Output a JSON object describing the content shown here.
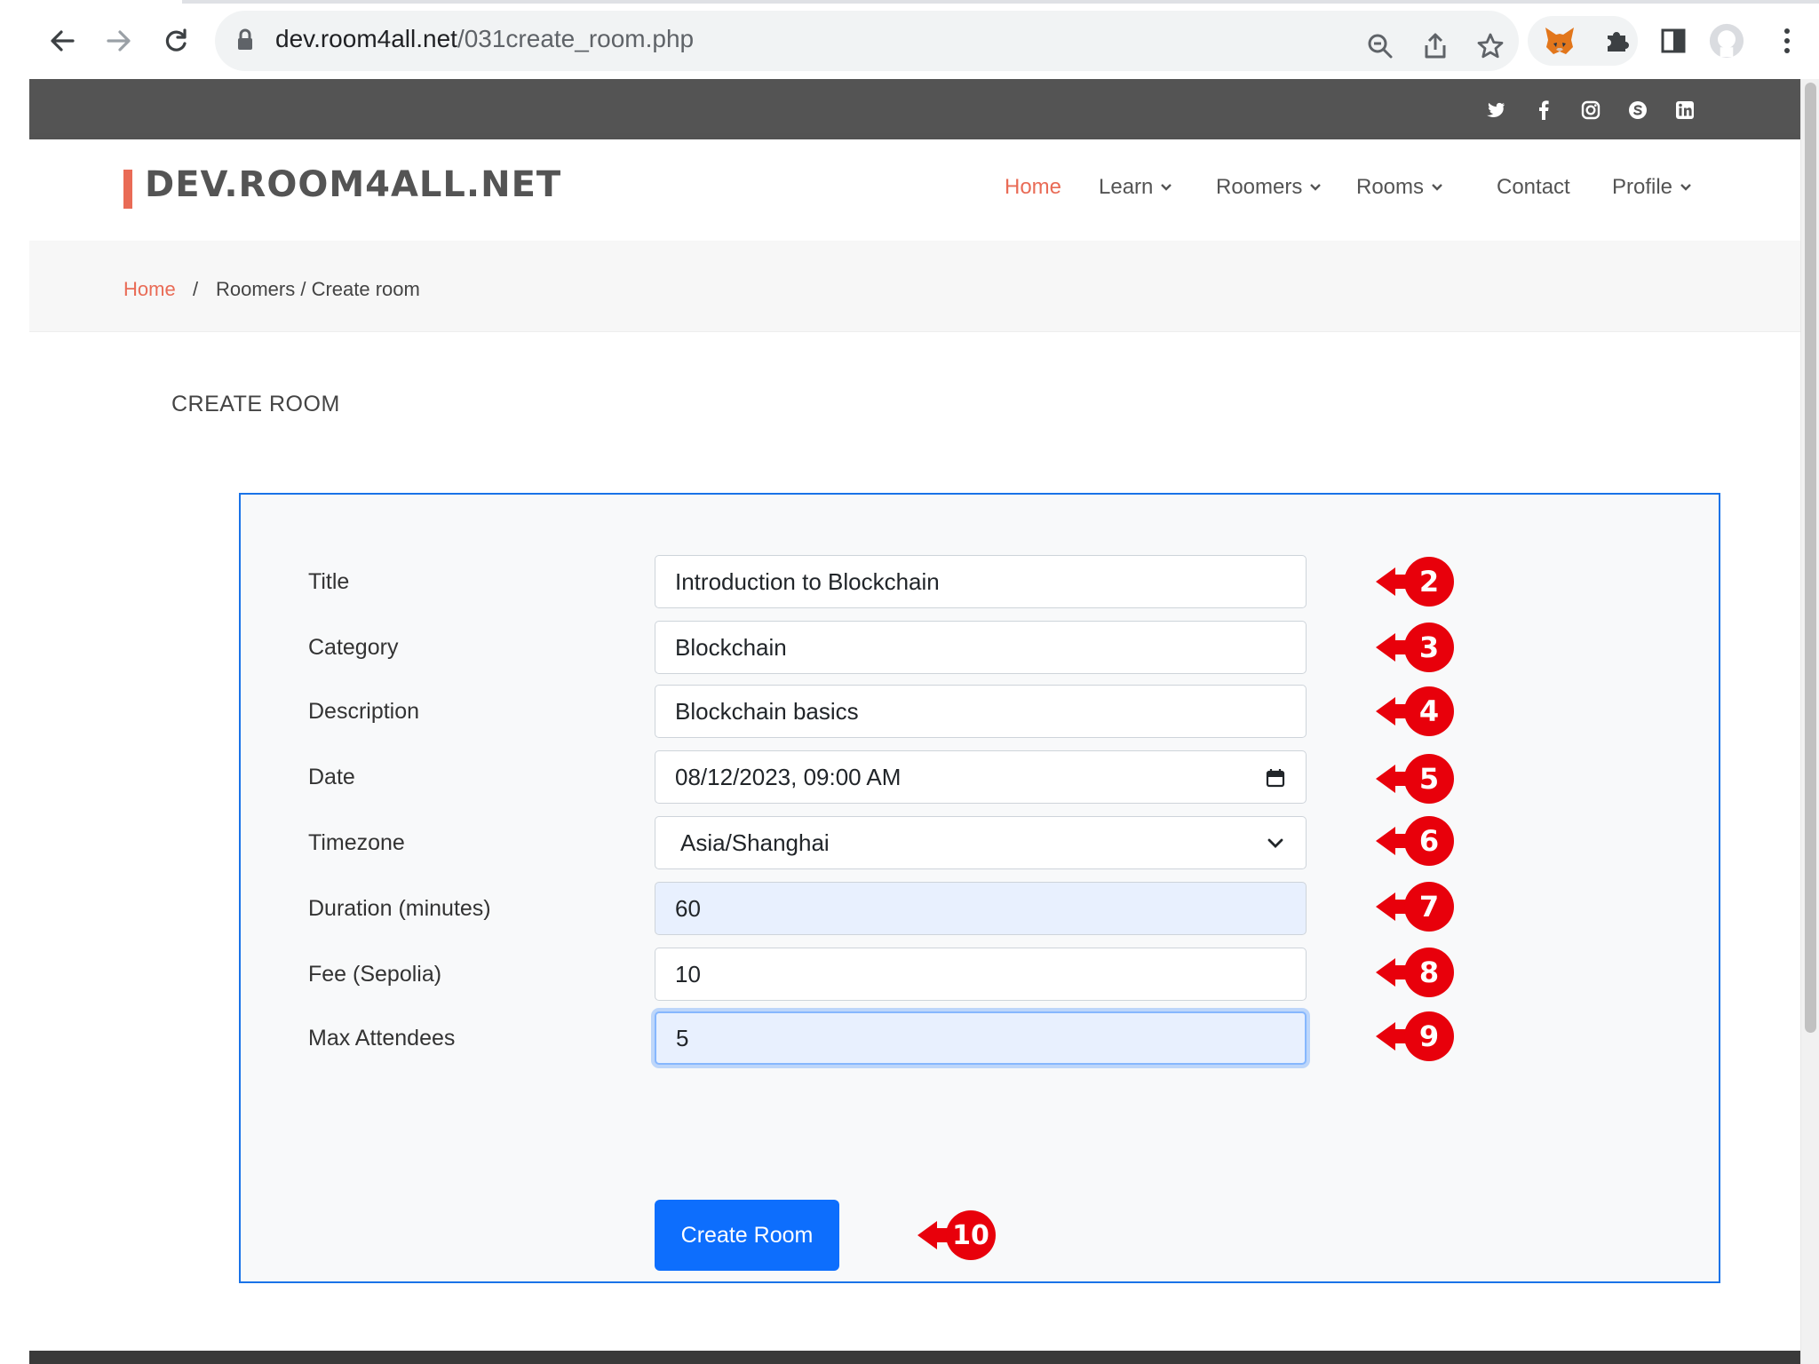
{
  "browser": {
    "url_host": "dev.room4all.net",
    "url_path": "/031create_room.php"
  },
  "site": {
    "logo": "DEV.ROOM4ALL.NET",
    "accent_color": "#e96b56",
    "nav": [
      {
        "label": "Home",
        "active": true
      },
      {
        "label": "Learn",
        "dropdown": true
      },
      {
        "label": "Roomers",
        "dropdown": true
      },
      {
        "label": "Rooms",
        "dropdown": true
      },
      {
        "label": "Contact"
      },
      {
        "label": "Profile",
        "dropdown": true
      }
    ],
    "social_icons": [
      "twitter-icon",
      "facebook-icon",
      "instagram-icon",
      "skype-icon",
      "linkedin-icon"
    ]
  },
  "breadcrumb": {
    "home": "Home",
    "separator": "/",
    "current": "Roomers / Create room"
  },
  "page": {
    "title": "CREATE ROOM"
  },
  "form": {
    "fields": [
      {
        "label": "Title",
        "value": "Introduction to Blockchain"
      },
      {
        "label": "Category",
        "value": "Blockchain"
      },
      {
        "label": "Description",
        "value": "Blockchain basics"
      },
      {
        "label": "Date",
        "value": "08/12/2023, 09:00 AM"
      },
      {
        "label": "Timezone",
        "value": "Asia/Shanghai"
      },
      {
        "label": "Duration (minutes)",
        "value": "60"
      },
      {
        "label": "Fee (Sepolia)",
        "value": "10"
      },
      {
        "label": "Max Attendees",
        "value": "5"
      }
    ],
    "submit_label": "Create Room"
  },
  "annotations": [
    "2",
    "3",
    "4",
    "5",
    "6",
    "7",
    "8",
    "9",
    "10"
  ],
  "annotation_color": "#e8000b",
  "button_color": "#0d6efd"
}
